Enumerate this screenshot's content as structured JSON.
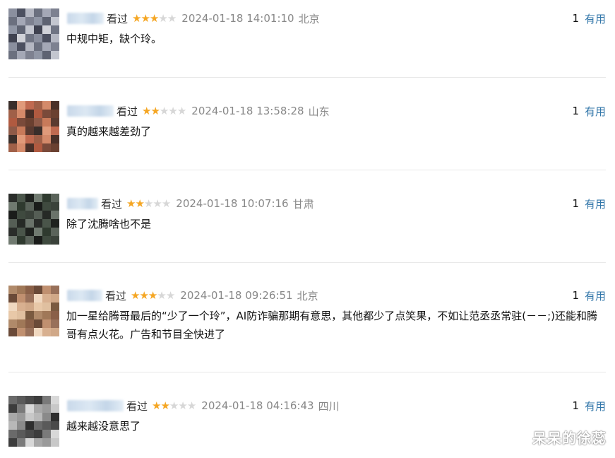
{
  "comments": [
    {
      "seen_label": "看过",
      "rating": 3,
      "time": "2024-01-18 14:01:10",
      "location": "北京",
      "useful_count": "1",
      "useful_label": "有用",
      "text": "中规中矩，缺个玲。"
    },
    {
      "seen_label": "看过",
      "rating": 2,
      "time": "2024-01-18 13:58:28",
      "location": "山东",
      "useful_count": "1",
      "useful_label": "有用",
      "text": "真的越来越差劲了"
    },
    {
      "seen_label": "看过",
      "rating": 2,
      "time": "2024-01-18 10:07:16",
      "location": "甘肃",
      "useful_count": "1",
      "useful_label": "有用",
      "text": "除了沈腾啥也不是"
    },
    {
      "seen_label": "看过",
      "rating": 3,
      "time": "2024-01-18 09:26:51",
      "location": "北京",
      "useful_count": "1",
      "useful_label": "有用",
      "text": "加一星给腾哥最后的“少了一个玲”，AI防诈骗那期有意思，其他都少了点笑果，不如让范丞丞常驻(－－;)还能和腾哥有点火花。广告和节目全快进了"
    },
    {
      "seen_label": "看过",
      "rating": 2,
      "time": "2024-01-18 04:16:43",
      "location": "四川",
      "useful_count": "1",
      "useful_label": "有用",
      "text": "越来越没意思了"
    }
  ],
  "watermark": "呆呆的徐蕊",
  "colors": {
    "star_on": "#f5a623",
    "star_off": "#d7d7d7",
    "useful_link": "#3377aa",
    "meta_gray": "#888888",
    "divider": "#e8e8e8"
  }
}
